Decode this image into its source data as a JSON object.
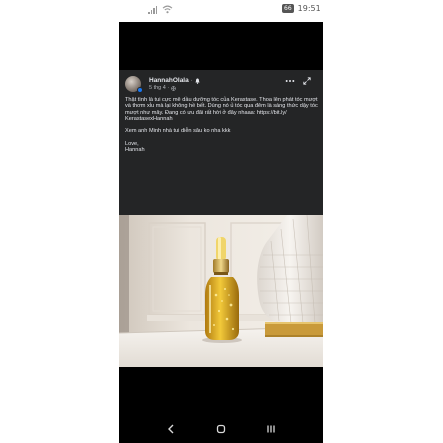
{
  "status_bar": {
    "battery": "66",
    "time": "19:51"
  },
  "post": {
    "author": "HannahOlala",
    "separator": "·",
    "timestamp": "5 thg 4 ·",
    "paragraphs": [
      "Thật tình là tui cực mê dầu dưỡng tóc của Kerastase. Thoa lên phát tóc mượt và thơm xỉu mà lại không hề bết. Dùng nó ủ tóc qua đêm là sáng thức dậy tóc mượt như mây.  Đang có ưu đãi rất hời ở đây nhaaa: https://bit.ly/ KerastasexHannah",
      "Xem anh Minh nhà tui diễn sâu ko nha kkk",
      "Love,\nHannah"
    ]
  },
  "icons": {
    "verified": "verified-badge-icon",
    "bell": "bell-icon",
    "globe": "globe-icon",
    "more": "more-options-icon",
    "expand": "expand-icon",
    "back": "back-icon",
    "home": "home-icon",
    "recent": "recent-apps-icon"
  },
  "colors": {
    "card_background": "#242526",
    "text_primary": "#e4e6eb",
    "text_secondary": "#b0b3b8",
    "screen_background": "#000000"
  }
}
